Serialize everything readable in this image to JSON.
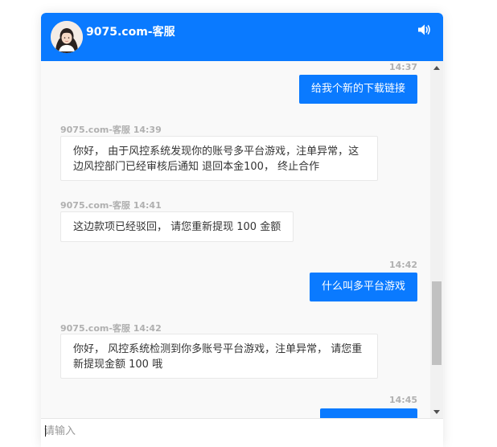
{
  "header": {
    "title": "9075.com-客服",
    "bg_color": "#0a7aff"
  },
  "icons": {
    "avatar": "agent-avatar",
    "speaker": "speaker-icon"
  },
  "messages": [
    {
      "side": "out",
      "time": "14:37",
      "text": "给我个新的下载链接"
    },
    {
      "side": "in",
      "sender_time": "9075.com-客服 14:39",
      "text": "你好， 由于风控系统发现你的账号多平台游戏，注单异常，这边风控部门已经审核后通知 退回本金100， 终止合作"
    },
    {
      "side": "in",
      "sender_time": "9075.com-客服 14:41",
      "text": "这边款项已经驳回， 请您重新提现 100 金额"
    },
    {
      "side": "out",
      "time": "14:42",
      "text": "什么叫多平台游戏"
    },
    {
      "side": "in",
      "sender_time": "9075.com-客服 14:42",
      "text": "你好， 风控系统检测到你多账号平台游戏，注单异常， 请您重新提现金额 100 哦"
    },
    {
      "side": "out",
      "time": "14:45",
      "text": ""
    }
  ],
  "input": {
    "placeholder": "请输入",
    "value": ""
  }
}
